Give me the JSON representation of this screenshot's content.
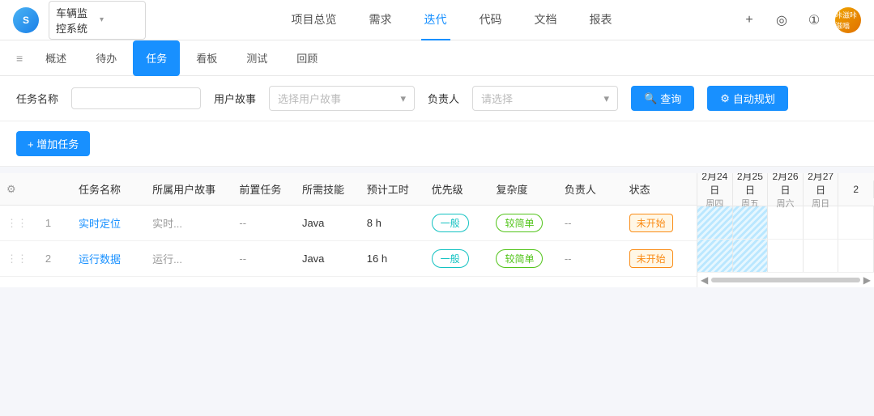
{
  "logo": {
    "text": "S"
  },
  "project": {
    "name": "车辆监控系统",
    "arrow": "▾"
  },
  "topNav": {
    "tabs": [
      {
        "label": "项目总览",
        "active": false
      },
      {
        "label": "需求",
        "active": false
      },
      {
        "label": "迭代",
        "active": true
      },
      {
        "label": "代码",
        "active": false
      },
      {
        "label": "文档",
        "active": false
      },
      {
        "label": "报表",
        "active": false
      }
    ],
    "plus": "+",
    "target_icon": "◎",
    "alert_icon": "①",
    "avatar_text": "咔滋咔滋嗡"
  },
  "subNav": {
    "arrow": "≡",
    "tabs": [
      {
        "label": "概述",
        "active": false
      },
      {
        "label": "待办",
        "active": false
      },
      {
        "label": "任务",
        "active": true
      },
      {
        "label": "看板",
        "active": false
      },
      {
        "label": "测试",
        "active": false
      },
      {
        "label": "回顾",
        "active": false
      }
    ]
  },
  "filter": {
    "task_name_label": "任务名称",
    "task_name_placeholder": "",
    "user_story_label": "用户故事",
    "user_story_placeholder": "选择用户故事",
    "owner_label": "负责人",
    "owner_placeholder": "请选择",
    "query_btn": "查询",
    "auto_btn": "自动规划"
  },
  "actions": {
    "add_btn": "+ 增加任务"
  },
  "table": {
    "columns": [
      {
        "key": "num",
        "label": ""
      },
      {
        "key": "name",
        "label": "任务名称"
      },
      {
        "key": "story",
        "label": "所属用户故事"
      },
      {
        "key": "pre",
        "label": "前置任务"
      },
      {
        "key": "skill",
        "label": "所需技能"
      },
      {
        "key": "time",
        "label": "预计工时"
      },
      {
        "key": "priority",
        "label": "优先级"
      },
      {
        "key": "complex",
        "label": "复杂度"
      },
      {
        "key": "owner",
        "label": "负责人"
      },
      {
        "key": "status",
        "label": "状态"
      }
    ],
    "rows": [
      {
        "num": "1",
        "name": "实时定位",
        "story": "实时...",
        "pre": "--",
        "skill": "Java",
        "time": "8 h",
        "priority": "一般",
        "complex": "较简单",
        "owner": "--",
        "status": "未开始"
      },
      {
        "num": "2",
        "name": "运行数据",
        "story": "运行...",
        "pre": "--",
        "skill": "Java",
        "time": "16 h",
        "priority": "一般",
        "complex": "较简单",
        "owner": "--",
        "status": "未开始"
      }
    ]
  },
  "gantt": {
    "cols": [
      {
        "date": "2月24日",
        "weekday": "周四"
      },
      {
        "date": "2月25日",
        "weekday": "周五"
      },
      {
        "date": "2月26日",
        "weekday": "周六"
      },
      {
        "date": "2月27日",
        "weekday": "周日"
      },
      {
        "date": "2",
        "weekday": ""
      }
    ]
  }
}
